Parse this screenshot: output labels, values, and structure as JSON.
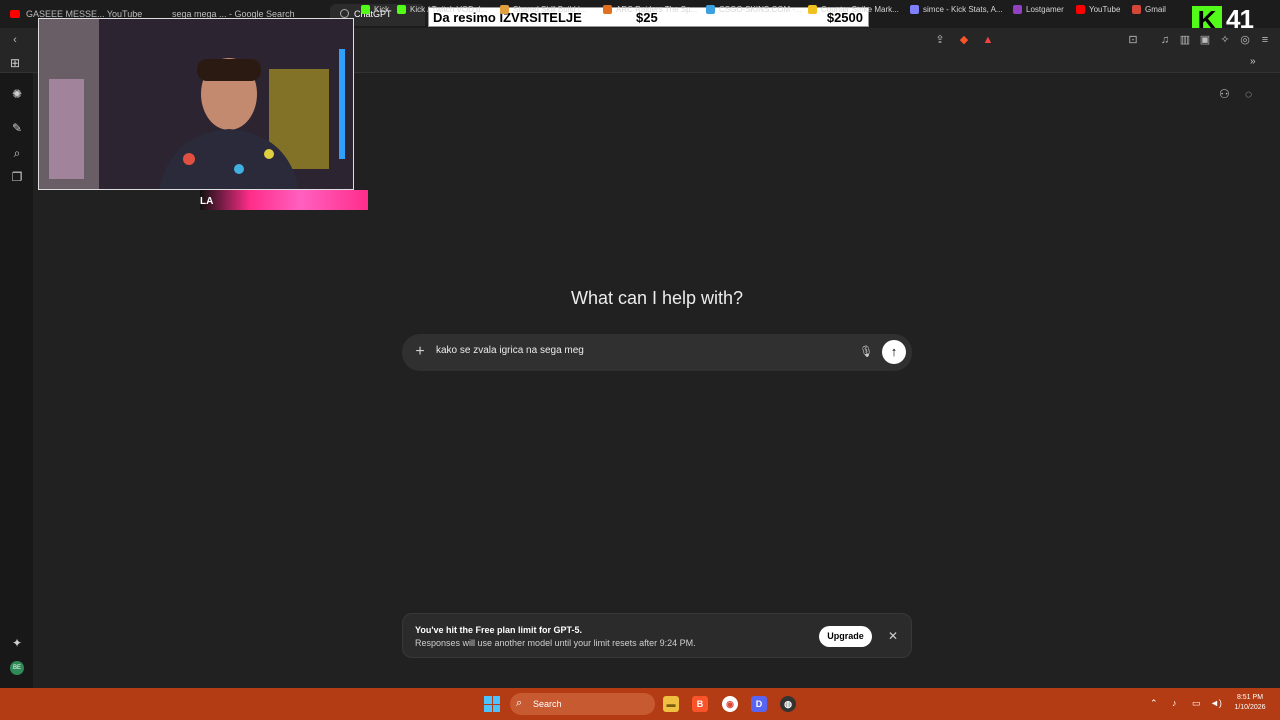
{
  "browser": {
    "tabs": [
      {
        "label": "GASEEE MESSE... YouTube"
      },
      {
        "label": "sega mega ... - Google Search"
      },
      {
        "label": "ChatGPT"
      }
    ],
    "bookmarks": [
      {
        "label": "Kick",
        "color": "#53fc18"
      },
      {
        "label": "Kick / Twitch VOD d...",
        "color": "#53fc18"
      },
      {
        "label": "Shared Skill Build |...",
        "color": "#e0a040"
      },
      {
        "label": "ARC Raiders The Sp...",
        "color": "#e07020"
      },
      {
        "label": "CSGO-SKINS.COM -...",
        "color": "#3aa0e0"
      },
      {
        "label": "Counter Strike Mark...",
        "color": "#f0c020"
      },
      {
        "label": "simce - Kick Stats, A...",
        "color": "#8080ff"
      },
      {
        "label": "Lostgamer",
        "color": "#9040c0"
      },
      {
        "label": "YouTube",
        "color": "#ff0000"
      },
      {
        "label": "Gmail",
        "color": "#d44638"
      }
    ],
    "more_icon": "chevron-double-right-icon"
  },
  "overlay": {
    "banner_text": "Da resimo IZVRSITELJE",
    "banner_amount1": "$25",
    "banner_amount2": "$2500",
    "kick_logo": "K",
    "viewer_count": "41",
    "cam_logo": "LA"
  },
  "main": {
    "heading": "What can I help with?",
    "prompt_text": "kako se zvala igrica na sega meg",
    "notice_title": "You've hit the Free plan limit for GPT-5.",
    "notice_body": "Responses will use another model until your limit resets after 9:24 PM.",
    "upgrade_label": "Upgrade"
  },
  "sidebar": {
    "avatar_initials": "BE"
  },
  "taskbar": {
    "search_label": "Search",
    "time": "8:51 PM",
    "date": "1/10/2026"
  }
}
